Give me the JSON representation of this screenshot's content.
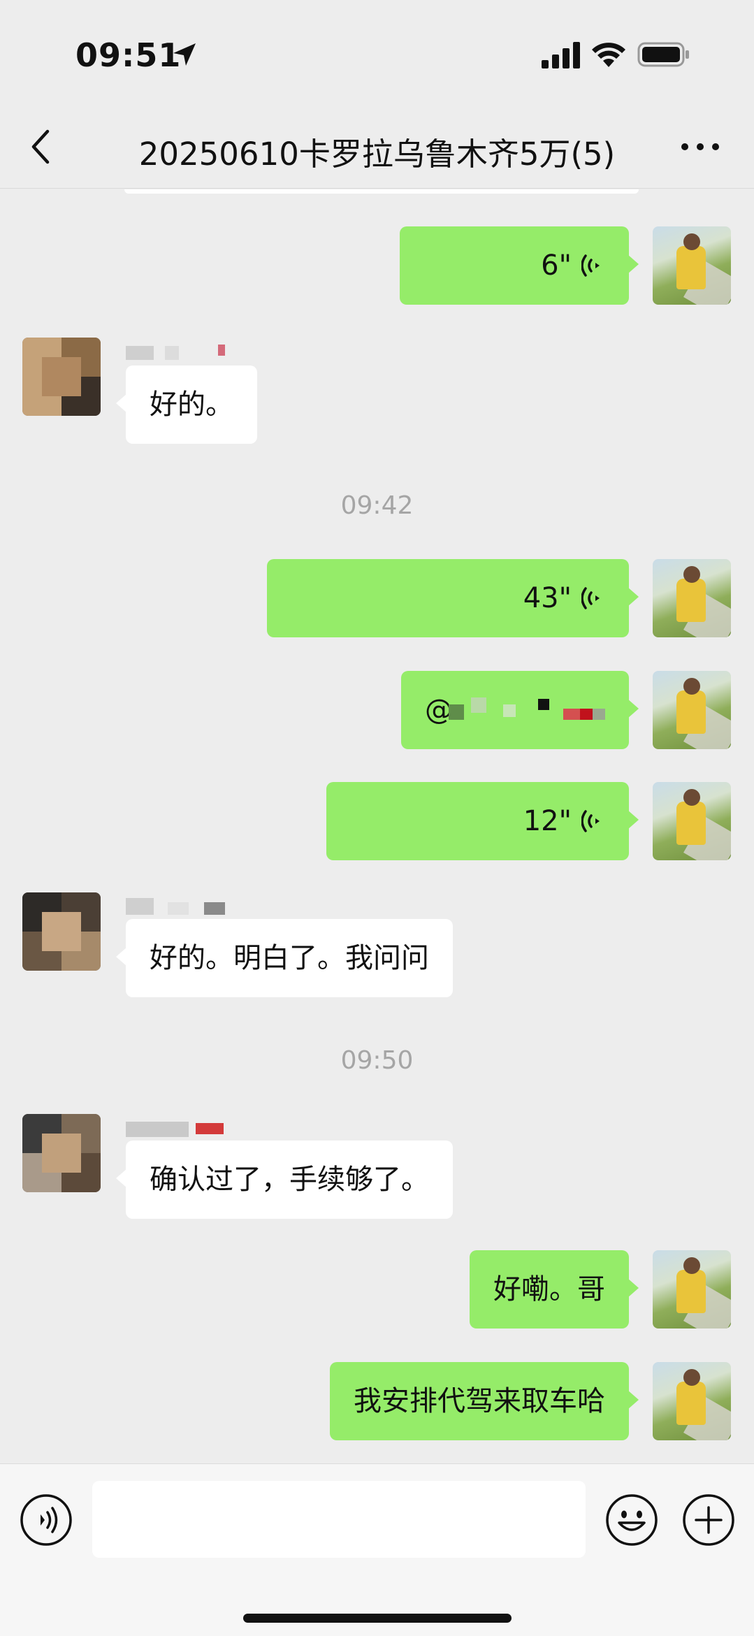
{
  "status_bar": {
    "time": "09:51"
  },
  "nav": {
    "title": "20250610卡罗拉乌鲁木齐5万(5)"
  },
  "messages": {
    "m1_duration": "6\"",
    "m2_text": "好的。",
    "ts1": "09:42",
    "m3_duration": "43\"",
    "m4_text": "@",
    "m5_duration": "12\"",
    "m6_text": "好的。明白了。我问问",
    "ts2": "09:50",
    "m7_text": "确认过了，手续够了。",
    "m8_text": "好嘞。哥",
    "m9_text": "我安排代驾来取车哈"
  },
  "input": {
    "value": "",
    "placeholder": ""
  },
  "colors": {
    "self_bubble": "#95ec69",
    "other_bubble": "#ffffff",
    "background": "#ededed"
  }
}
